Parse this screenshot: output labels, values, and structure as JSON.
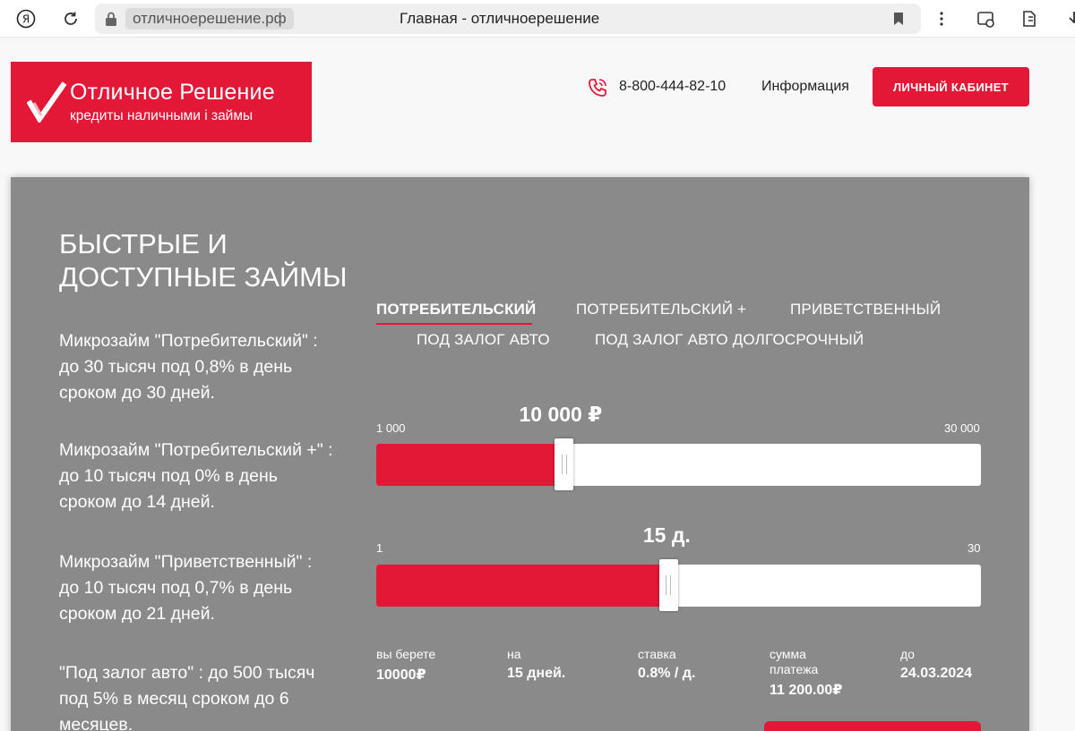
{
  "browser": {
    "host": "отличноерешение.рф",
    "tab_title": "Главная - отличноерешение"
  },
  "logo": {
    "name": "Отличное Решение",
    "tagline": "кредиты наличными і займы"
  },
  "header": {
    "phone": "8-800-444-82-10",
    "info_link": "Информация",
    "cabinet_button": "ЛИЧНЫЙ КАБИНЕТ"
  },
  "hero": {
    "heading_line1": "БЫСТРЫЕ И",
    "heading_line2": "ДОСТУПНЫЕ ЗАЙМЫ",
    "promos": [
      {
        "line1": "Микрозайм \"Потребительский\" :",
        "line2": "до 30 тысяч под 0,8% в день",
        "line3": "сроком до 30 дней."
      },
      {
        "line1": "Микрозайм \"Потребительский +\" :",
        "line2": "до 10 тысяч под 0% в день",
        "line3": "сроком до 14 дней."
      },
      {
        "line1": "Микрозайм \"Приветственный\" :",
        "line2": "до 10 тысяч под 0,7% в день",
        "line3": "сроком до 21 дней."
      },
      {
        "line1": "\"Под залог авто\" : до 500 тысяч",
        "line2": "под 5% в месяц сроком до 6",
        "line3": "месяцев."
      }
    ]
  },
  "tabs": [
    {
      "label": "ПОТРЕБИТЕЛЬСКИЙ",
      "active": true
    },
    {
      "label": "ПОТРЕБИТЕЛЬСКИЙ +",
      "active": false
    },
    {
      "label": "ПРИВЕТСТВЕННЫЙ",
      "active": false
    },
    {
      "label": "ПОД ЗАЛОГ АВТО",
      "active": false
    },
    {
      "label": "ПОД ЗАЛОГ АВТО ДОЛГОСРОЧНЫЙ",
      "active": false
    }
  ],
  "amount_slider": {
    "min_label": "1 000",
    "max_label": "30 000",
    "value_label": "10 000 ₽",
    "min": 1000,
    "max": 30000,
    "value": 10000
  },
  "term_slider": {
    "min_label": "1",
    "max_label": "30",
    "value_label": "15 д.",
    "min": 1,
    "max": 30,
    "value": 15
  },
  "summary": [
    {
      "label": "вы берете",
      "value": "10000₽"
    },
    {
      "label": "на",
      "value": "15 дней."
    },
    {
      "label": "ставка",
      "value": "0.8% / д."
    },
    {
      "label": "сумма\nплатежа",
      "value": "11 200.00₽"
    },
    {
      "label": "до",
      "value": "24.03.2024"
    }
  ],
  "colors": {
    "accent": "#e31837",
    "panel": "#8a8a8a"
  }
}
